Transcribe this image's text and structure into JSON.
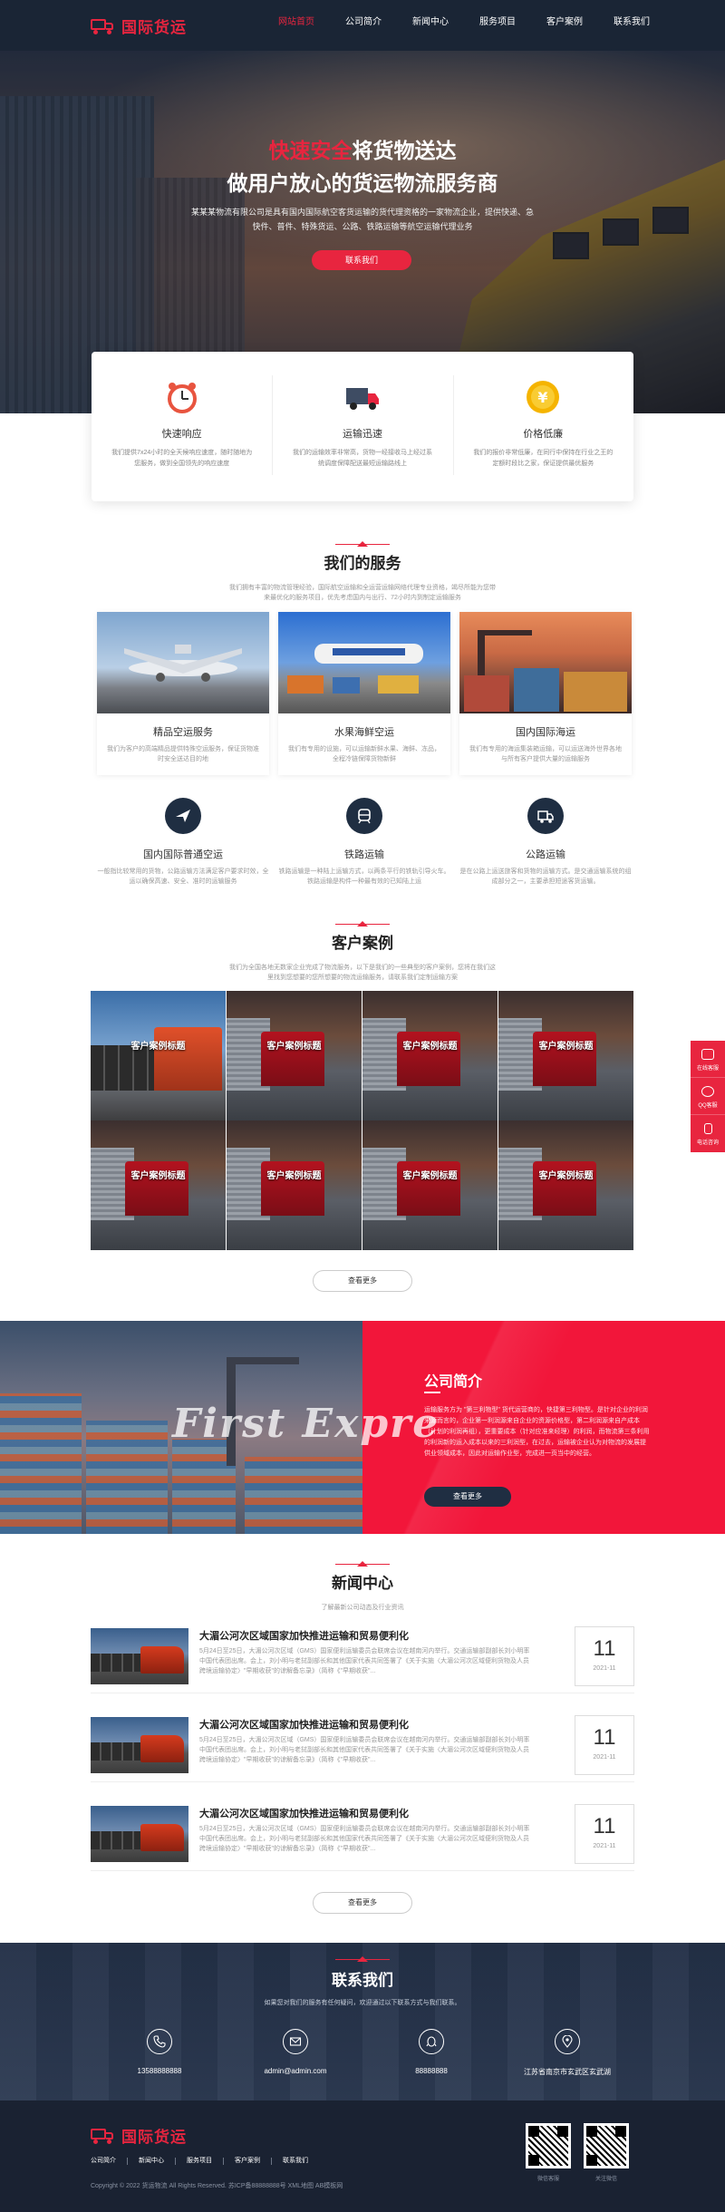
{
  "brand": {
    "name": "国际货运",
    "accent": "#e8253f",
    "dark": "#1a2535"
  },
  "nav": {
    "items": [
      {
        "label": "网站首页"
      },
      {
        "label": "公司简介"
      },
      {
        "label": "新闻中心"
      },
      {
        "label": "服务项目"
      },
      {
        "label": "客户案例"
      },
      {
        "label": "联系我们"
      }
    ],
    "active": "网站首页"
  },
  "hero": {
    "title_highlight": "快速安全",
    "title_rest": "将货物送达",
    "title_line2": "做用户放心的货运物流服务商",
    "desc": "某某某物流有限公司是具有国内国际航空客货运输的货代理资格的一家物流企业，提供快递、急快件、普件、特殊货运、公路、铁路运输等航空运输代理业务",
    "button": "联系我们"
  },
  "features": [
    {
      "icon": "alarm-clock-icon",
      "title": "快速响应",
      "desc": "我们提供7x24小时的全天候响应速度，随时随地为您服务，做到全国领先的响应速度"
    },
    {
      "icon": "delivery-truck-icon",
      "title": "运输迅速",
      "desc": "我们的运输效率非常高，货物一经接收马上经过系统调度保障配送最短运输路线上"
    },
    {
      "icon": "yen-coin-icon",
      "title": "价格低廉",
      "desc": "我们的报价非常低廉，在同行中保持在行业之王的定额时段比之家，保证提供最优服务"
    }
  ],
  "services": {
    "title": "我们的服务",
    "subtitle": "我们拥有丰富的物流管理经验，国际航空运输和全运营运输网络代理专业资格，竭尽所能为您带来最优化的服务项目，优先考虑国内与出行、72小时内到制定运输服务",
    "cards": [
      {
        "title": "精品空运服务",
        "desc": "我们为客户的高端精品提供特殊空运服务，保证货物准时安全送达目的地"
      },
      {
        "title": "水果海鲜空运",
        "desc": "我们有专用的设施，可以运输新鲜水果、海鲜、冻品，全程冷链保障货物新鲜"
      },
      {
        "title": "国内国际海运",
        "desc": "我们有专用的海运集装箱运输，可以运送海外世界各地与所有客户提供大量的运输服务"
      }
    ],
    "items": [
      {
        "icon": "airplane-icon",
        "title": "国内国际普通空运",
        "desc": "一般指比较常用的货物，公路运输方法满足客户要求时效，全运以确保高速、安全、准时的运输服务"
      },
      {
        "icon": "train-icon",
        "title": "铁路运输",
        "desc": "铁路运输是一种陆上运输方式，以两条平行的铁轨引导火车。铁路运输是构件一种最有效的已知陆上运"
      },
      {
        "icon": "truck-icon",
        "title": "公路运输",
        "desc": "是在公路上运送旅客和货物的运输方式。是交通运输系统的组成部分之一，主要承担短途客货运输。"
      }
    ]
  },
  "cases": {
    "title": "客户案例",
    "subtitle": "我们为全国各地无数家企业完成了物流服务，以下是我们的一些典型的客户案例，您将在我们这里找到您想要的您所想要的物流运输服务，请联系我们定制运输方案",
    "items": [
      {
        "label": "客户案例标题"
      },
      {
        "label": "客户案例标题"
      },
      {
        "label": "客户案例标题"
      },
      {
        "label": "客户案例标题"
      },
      {
        "label": "客户案例标题"
      },
      {
        "label": "客户案例标题"
      },
      {
        "label": "客户案例标题"
      },
      {
        "label": "客户案例标题"
      }
    ],
    "more": "查看更多"
  },
  "about": {
    "script_text": "First Expre",
    "title": "公司简介",
    "desc": "运输服务方为 \"第三利物型\" 货代运营商的，快捷第三利物型。是针对企业的利润来源而言的，企业第一利润源来自企业的资源价格型，第二利润源来自产成本（计划的利润再组），更重要成本（针对应准来经理）的利润，而物流第三条利用的利润新的运入成本以来的三利润型，在过去，运输被企业认为对物流的发展提供业领域成本，因此对运输作业型，完成进一页当中的经营。",
    "button": "查看更多"
  },
  "news": {
    "title": "新闻中心",
    "subtitle": "了解最新公司动态及行业资讯",
    "items": [
      {
        "title": "大湄公河次区域国家加快推进运输和贸易便利化",
        "desc": "5月24日至25日，大湄公河次区域（GMS）国家便利运输委员会联席会议在越南河内举行。交通运输部副部长刘小明率中国代表团出席。会上，刘小明与老挝副部长和其他国家代表共同签署了《关于实施〈大湄公河次区域便利货物及人员跨境运输协定〉\"早期收获\"的谅解备忘录》（简称《\"早期收获\"...",
        "day": "11",
        "ym": "2021-11"
      },
      {
        "title": "大湄公河次区域国家加快推进运输和贸易便利化",
        "desc": "5月24日至25日，大湄公河次区域（GMS）国家便利运输委员会联席会议在越南河内举行。交通运输部副部长刘小明率中国代表团出席。会上，刘小明与老挝副部长和其他国家代表共同签署了《关于实施〈大湄公河次区域便利货物及人员跨境运输协定〉\"早期收获\"的谅解备忘录》（简称《\"早期收获\"...",
        "day": "11",
        "ym": "2021-11"
      },
      {
        "title": "大湄公河次区域国家加快推进运输和贸易便利化",
        "desc": "5月24日至25日，大湄公河次区域（GMS）国家便利运输委员会联席会议在越南河内举行。交通运输部副部长刘小明率中国代表团出席。会上，刘小明与老挝副部长和其他国家代表共同签署了《关于实施〈大湄公河次区域便利货物及人员跨境运输协定〉\"早期收获\"的谅解备忘录》（简称《\"早期收获\"...",
        "day": "11",
        "ym": "2021-11"
      }
    ],
    "more": "查看更多"
  },
  "contact": {
    "title": "联系我们",
    "subtitle": "如果您对我们的服务有任何疑问，欢迎通过以下联系方式与我们联系。",
    "items": [
      {
        "icon": "phone-icon",
        "value": "13588888888"
      },
      {
        "icon": "mail-icon",
        "value": "admin@admin.com"
      },
      {
        "icon": "qq-icon",
        "value": "88888888"
      },
      {
        "icon": "location-icon",
        "value": "江苏省南京市玄武区玄武湖"
      }
    ]
  },
  "footer": {
    "links": [
      "公司简介",
      "新闻中心",
      "服务项目",
      "客户案例",
      "联系我们"
    ],
    "copyright": "Copyright © 2022 货运物流 All Rights Reserved. 苏ICP备88888888号 XML地图 AB模板网",
    "qr": [
      {
        "label": "微信客服"
      },
      {
        "label": "关注微信"
      }
    ]
  },
  "side": [
    {
      "icon": "chat-icon",
      "label": "在线客服"
    },
    {
      "icon": "qq-icon",
      "label": "QQ客服"
    },
    {
      "icon": "phone-icon",
      "label": "电话咨询"
    }
  ]
}
